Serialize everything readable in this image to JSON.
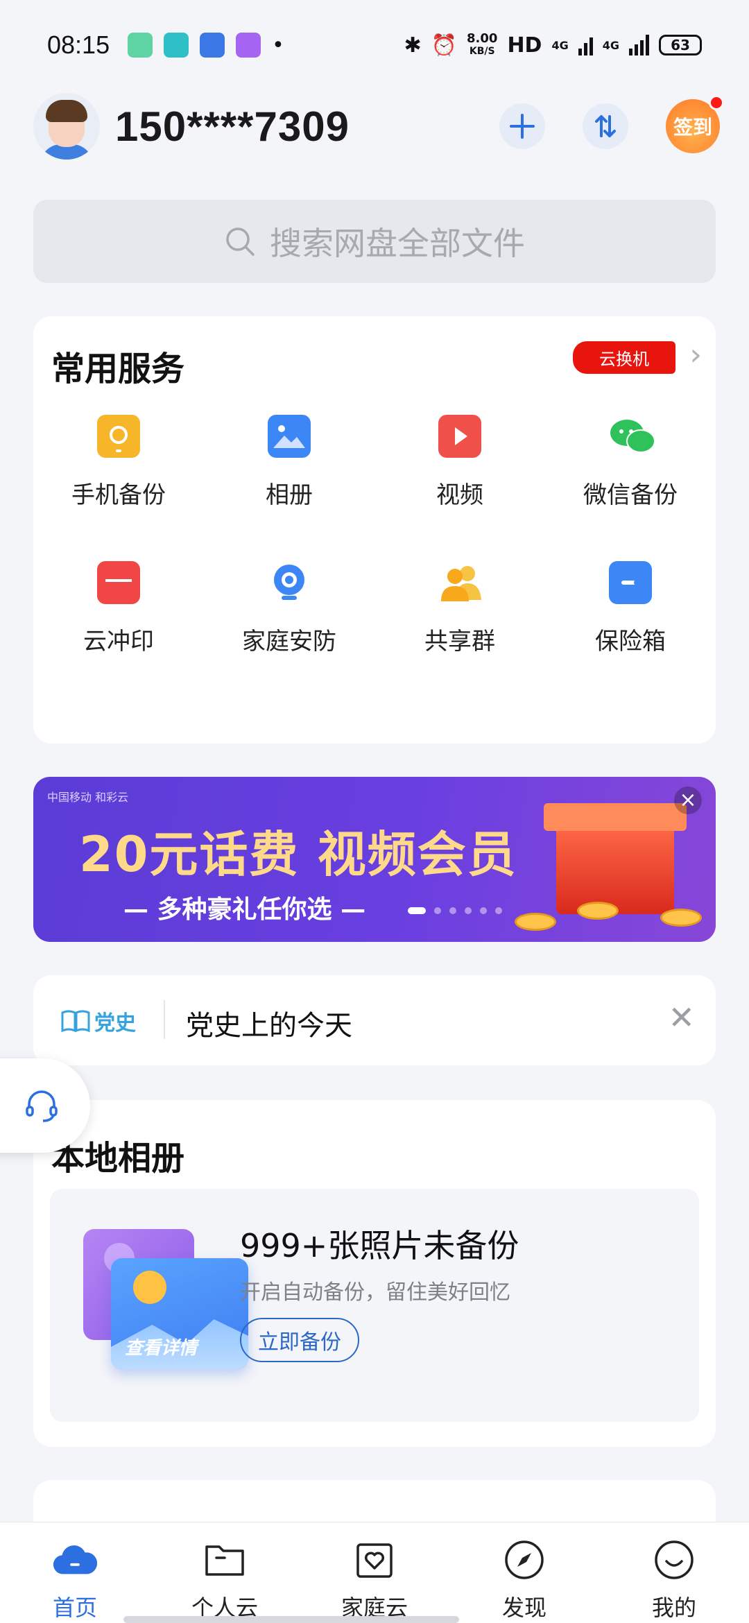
{
  "status_bar": {
    "time": "08:15",
    "net_speed_value": "8.00",
    "net_speed_unit": "KB/S",
    "hd": "HD",
    "signal1": "4G",
    "signal2": "4G",
    "battery": "63"
  },
  "header": {
    "phone": "150****7309",
    "signin_label": "签到"
  },
  "search": {
    "placeholder": "搜索网盘全部文件"
  },
  "services": {
    "title": "常用服务",
    "badge": "云换机",
    "items": [
      {
        "label": "手机备份",
        "icon": "phone-backup-icon",
        "color": "#f7b529"
      },
      {
        "label": "相册",
        "icon": "album-icon",
        "color": "#3d86f5"
      },
      {
        "label": "视频",
        "icon": "video-icon",
        "color": "#f0504a"
      },
      {
        "label": "微信备份",
        "icon": "wechat-icon",
        "color": "#2fc25b"
      },
      {
        "label": "云冲印",
        "icon": "printer-icon",
        "color": "#f04646"
      },
      {
        "label": "家庭安防",
        "icon": "camera-icon",
        "color": "#3d86f5"
      },
      {
        "label": "共享群",
        "icon": "group-icon",
        "color": "#f7b529"
      },
      {
        "label": "保险箱",
        "icon": "safe-icon",
        "color": "#3d86f5"
      }
    ]
  },
  "banner": {
    "logo": "中国移动 和彩云",
    "title": "20元话费 视频会员",
    "subtitle": "— 多种豪礼任你选 —"
  },
  "history": {
    "tag": "党史",
    "text": "党史上的今天"
  },
  "album": {
    "title": "本地相册",
    "count": "999+张照片未备份",
    "desc": "开启自动备份，留住美好回忆",
    "button": "立即备份",
    "card_caption": "查看详情"
  },
  "tabs": [
    {
      "label": "首页",
      "icon": "cloud-home-icon",
      "active": true
    },
    {
      "label": "个人云",
      "icon": "folder-icon",
      "active": false
    },
    {
      "label": "家庭云",
      "icon": "family-heart-icon",
      "active": false
    },
    {
      "label": "发现",
      "icon": "compass-icon",
      "active": false
    },
    {
      "label": "我的",
      "icon": "smile-icon",
      "active": false
    }
  ],
  "colors": {
    "accent": "#2b6fe0",
    "badge_red": "#e8150f"
  }
}
